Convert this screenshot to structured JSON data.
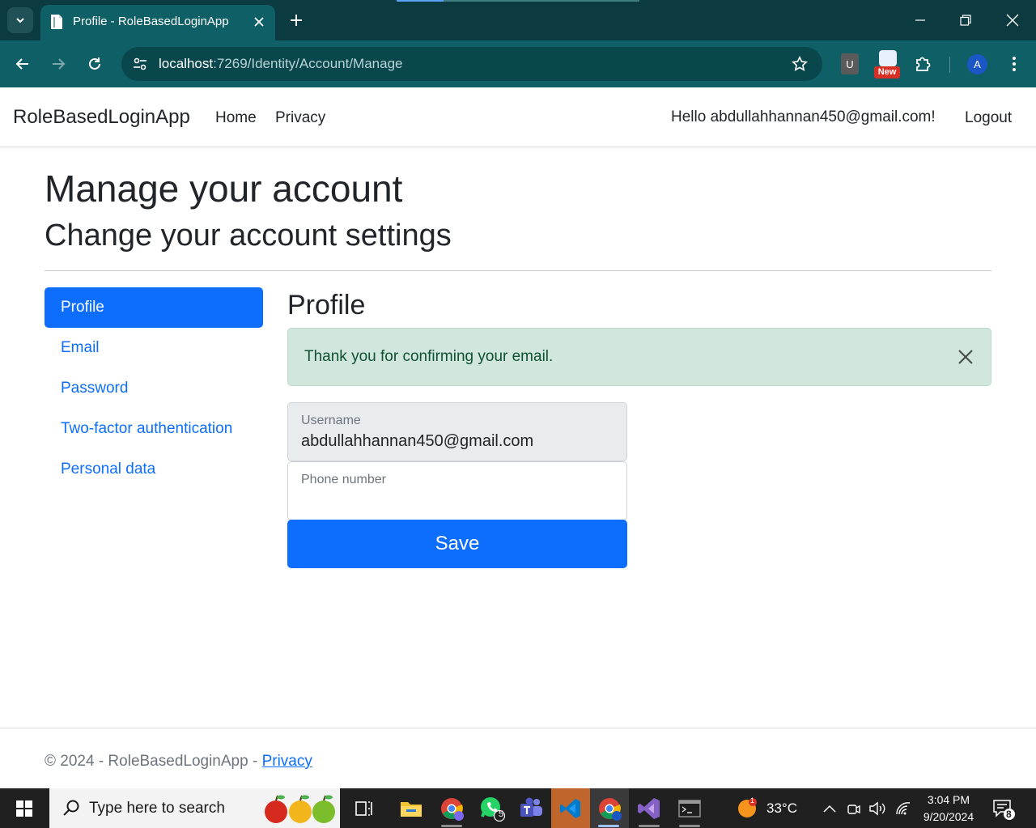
{
  "browser": {
    "tab_title": "Profile - RoleBasedLoginApp",
    "url_host": "localhost",
    "url_path": ":7269/Identity/Account/Manage",
    "ext_u_label": "U",
    "ext_new_badge": "New",
    "profile_initial": "A"
  },
  "site": {
    "brand": "RoleBasedLoginApp",
    "nav": {
      "home": "Home",
      "privacy": "Privacy"
    },
    "hello": "Hello abdullahhannan450@gmail.com!",
    "logout": "Logout"
  },
  "page": {
    "title": "Manage your account",
    "subtitle": "Change your account settings",
    "sidenav": [
      {
        "label": "Profile",
        "active": true
      },
      {
        "label": "Email"
      },
      {
        "label": "Password"
      },
      {
        "label": "Two-factor authentication"
      },
      {
        "label": "Personal data"
      }
    ],
    "section_title": "Profile",
    "alert": "Thank you for confirming your email.",
    "username_label": "Username",
    "username_value": "abdullahhannan450@gmail.com",
    "phone_label": "Phone number",
    "phone_value": "",
    "save_label": "Save"
  },
  "footer": {
    "prefix": "© 2024 - RoleBasedLoginApp - ",
    "privacy": "Privacy"
  },
  "taskbar": {
    "search_placeholder": "Type here to search",
    "whatsapp_badge": "5",
    "weather_badge": "1",
    "temperature": "33°C",
    "time": "3:04 PM",
    "date": "9/20/2024",
    "notification_count": "8"
  },
  "colors": {
    "primary": "#0d6efd",
    "alert_bg": "#d1e7dd",
    "alert_text": "#0f5132",
    "chrome_bg": "#0e5f66"
  }
}
